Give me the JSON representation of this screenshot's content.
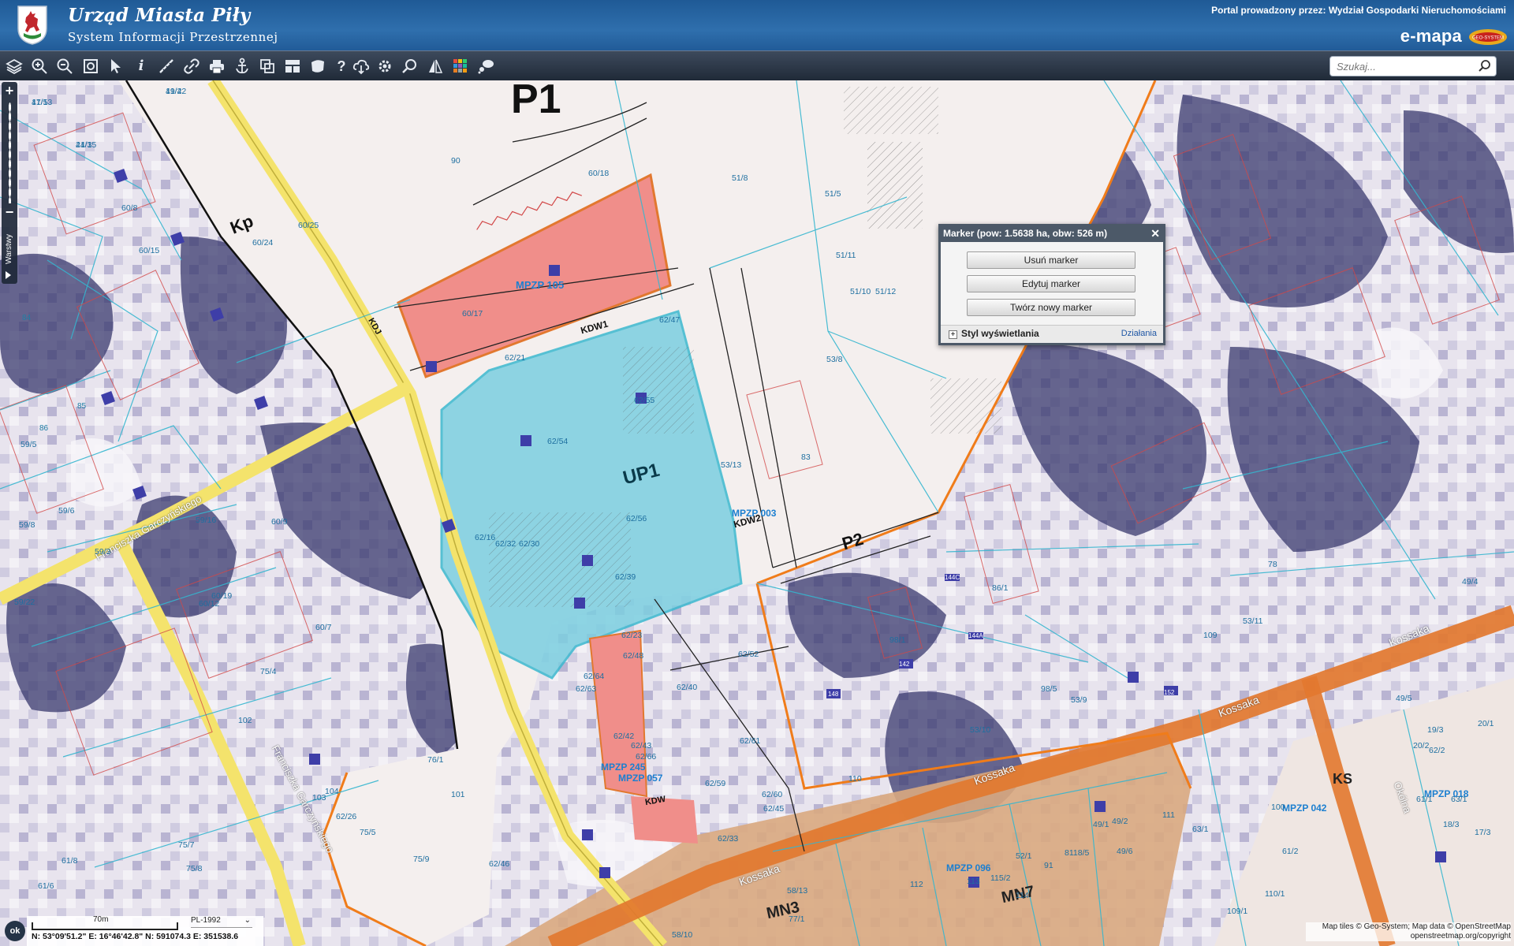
{
  "header": {
    "title": "Urząd Miasta Piły",
    "subtitle": "System Informacji Przestrzennej",
    "portal_text": "Portal prowadzony przez: Wydział Gospodarki Nieruchomościami",
    "brand": "e-mapa"
  },
  "toolbar": {
    "icons": [
      "layers-icon",
      "zoom-in-icon",
      "zoom-out-icon",
      "zoom-extent-icon",
      "select-pointer-icon",
      "info-icon",
      "measure-line-icon",
      "link-icon",
      "print-icon",
      "anchor-icon",
      "copy-icon",
      "layout-icon",
      "area-icon",
      "help-icon",
      "cloud-download-icon",
      "settings-icon",
      "search-map-icon",
      "compare-icon",
      "color-grid-icon",
      "comment-icon"
    ],
    "search_placeholder": "Szukaj..."
  },
  "left_rail": {
    "zoom_in": "+",
    "zoom_out": "−",
    "layers_label": "Warstwy"
  },
  "popup": {
    "title": "Marker (pow: 1.5638 ha, obw: 526 m)",
    "buttons": [
      "Usuń marker",
      "Edytuj marker",
      "Twórz nowy marker"
    ],
    "style_label": "Styl wyświetlania",
    "actions_label": "Działania"
  },
  "map_labels": {
    "zones": [
      "P1",
      "Kp",
      "UP1",
      "P2",
      "MN3",
      "MN7",
      "KS"
    ],
    "plans": [
      "MPZP 105",
      "MPZP 003",
      "MPZP 245",
      "MPZP 057",
      "MPZP 096",
      "MPZP 042",
      "MPZP 018"
    ],
    "streets": [
      "Franciszka Garczyńskiego",
      "Franciszka Garczyńskiego",
      "Kossaka",
      "Kossaka",
      "Kossaka",
      "Kossaka",
      "Okólna"
    ],
    "roads": [
      "KDW1",
      "KDW2",
      "KDJ",
      "KDW"
    ],
    "parcels": [
      "41/13",
      "41/42",
      "41/15",
      "60/8",
      "60/15",
      "60/24",
      "60/25",
      "90",
      "60/18",
      "60/17",
      "51/8",
      "51/5",
      "51/11",
      "51/10",
      "51/12",
      "62/47",
      "62/21",
      "62/54",
      "62/55",
      "53/8",
      "53/13",
      "83",
      "62/56",
      "62/16",
      "62/32",
      "62/30",
      "62/39",
      "62/23",
      "62/48",
      "62/52",
      "62/64",
      "62/63",
      "62/40",
      "62/61",
      "62/42",
      "62/43",
      "62/66",
      "62/59",
      "62/60",
      "62/45",
      "62/33",
      "59/5",
      "59/6",
      "59/8",
      "59/22",
      "59/3",
      "59/16",
      "60/9",
      "60/19",
      "60/7",
      "60/12",
      "75/4",
      "76/1",
      "101",
      "102",
      "103",
      "104",
      "62/26",
      "75/5",
      "75/7",
      "75/8",
      "75/9",
      "61/8",
      "61/6",
      "62/46",
      "58/10",
      "58/13",
      "77/1",
      "86/1",
      "98/1",
      "98/5",
      "53/9",
      "53/10",
      "110",
      "52/1",
      "109",
      "53/11",
      "78",
      "49/5",
      "49/4",
      "49/2",
      "49/6",
      "49/1",
      "8118/5",
      "91",
      "114",
      "115/2",
      "113",
      "112",
      "111",
      "110/1",
      "109/1",
      "100",
      "63/1",
      "61/2",
      "62/2",
      "61/1",
      "63/1",
      "19/3",
      "20/1",
      "20/2",
      "18/3",
      "17/3",
      "17/5",
      "19/2",
      "24/3"
    ],
    "numbers": [
      "84",
      "85",
      "86",
      "142",
      "148",
      "144C",
      "144A",
      "152"
    ]
  },
  "status": {
    "ok": "ok",
    "scale_label": "70m",
    "crs": "PL-1992",
    "coords": "N: 53°09'51.2\"  E: 16°46'42.8\"  N: 591074.3  E: 351538.6",
    "attribution_1": "Map tiles © Geo-System; Map data © OpenStreetMap",
    "attribution_2": "openstreetmap.org/copyright"
  },
  "colors": {
    "header_blue": "#2f6fad",
    "toolbar_dark": "#2a3647",
    "plan_red": "#f08e8a",
    "plan_blue": "#7ccfe0",
    "zone_brown": "#d9a880",
    "road_orange": "#e2782f",
    "street_yellow": "#f4e36c",
    "parcel_cyan": "#35b6cf",
    "boundary_orange": "#f07c1a"
  }
}
